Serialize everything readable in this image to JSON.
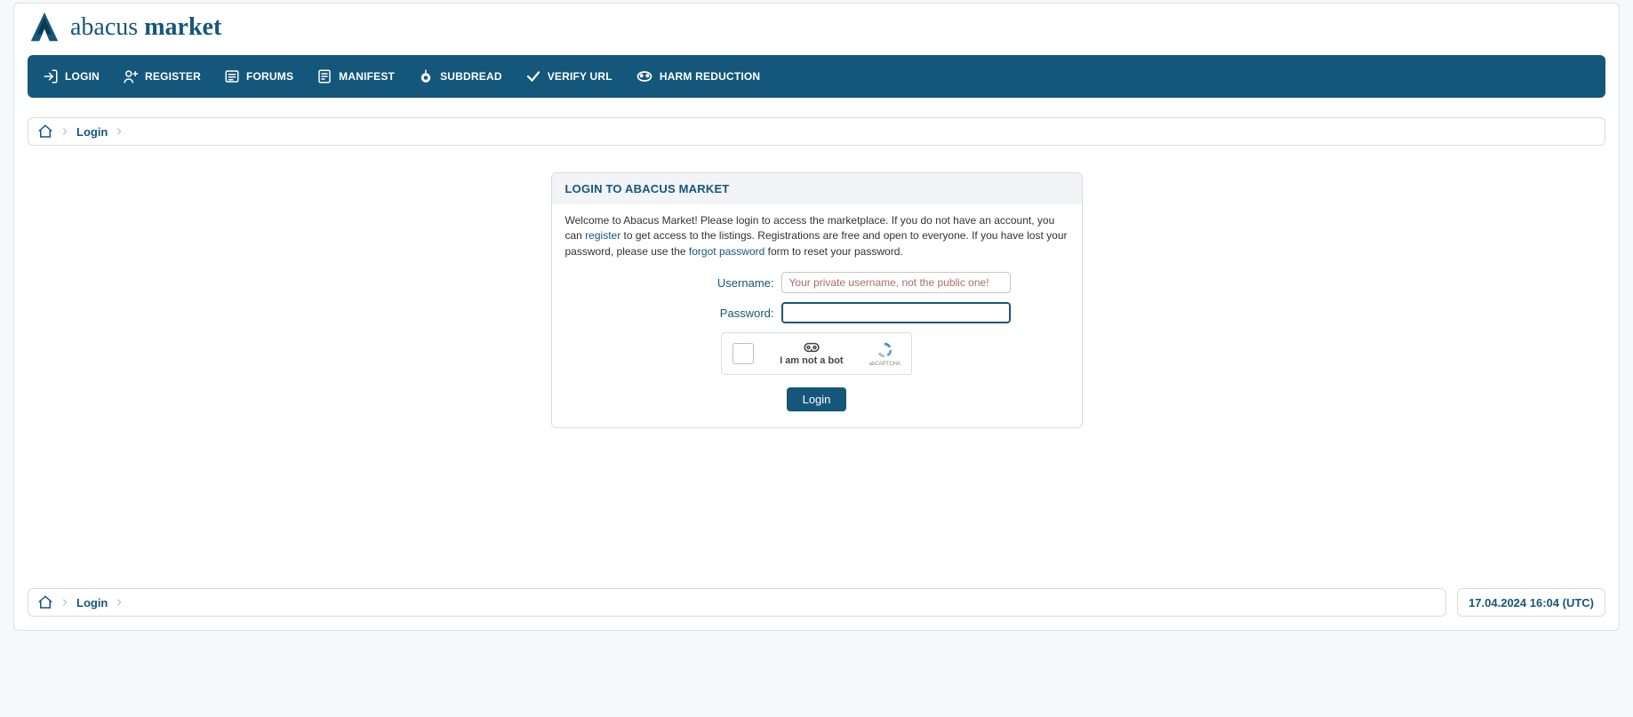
{
  "brand": {
    "word1": "abacus",
    "word2": "market"
  },
  "nav": {
    "items": [
      {
        "label": "LOGIN"
      },
      {
        "label": "REGISTER"
      },
      {
        "label": "FORUMS"
      },
      {
        "label": "MANIFEST"
      },
      {
        "label": "SUBDREAD"
      },
      {
        "label": "VERIFY URL"
      },
      {
        "label": "HARM REDUCTION"
      }
    ]
  },
  "breadcrumb": {
    "current": "Login"
  },
  "card": {
    "title": "LOGIN TO ABACUS MARKET",
    "intro_part1": "Welcome to Abacus Market! Please login to access the marketplace. If you do not have an account, you can ",
    "register_link": "register",
    "intro_part2": " to get access to the listings. Registrations are free and open to everyone. If you have lost your password, please use the ",
    "forgot_link": "forgot password",
    "intro_part3": " form to reset your password.",
    "form": {
      "username_label": "Username:",
      "username_placeholder": "Your private username, not the public one!",
      "password_label": "Password:",
      "captcha_label": "I am not a bot",
      "captcha_brand": "abCAPTCHA",
      "submit_label": "Login"
    }
  },
  "footer": {
    "breadcrumb": "Login",
    "timestamp": "17.04.2024 16:04 (UTC)"
  },
  "colors": {
    "primary": "#15577a"
  }
}
